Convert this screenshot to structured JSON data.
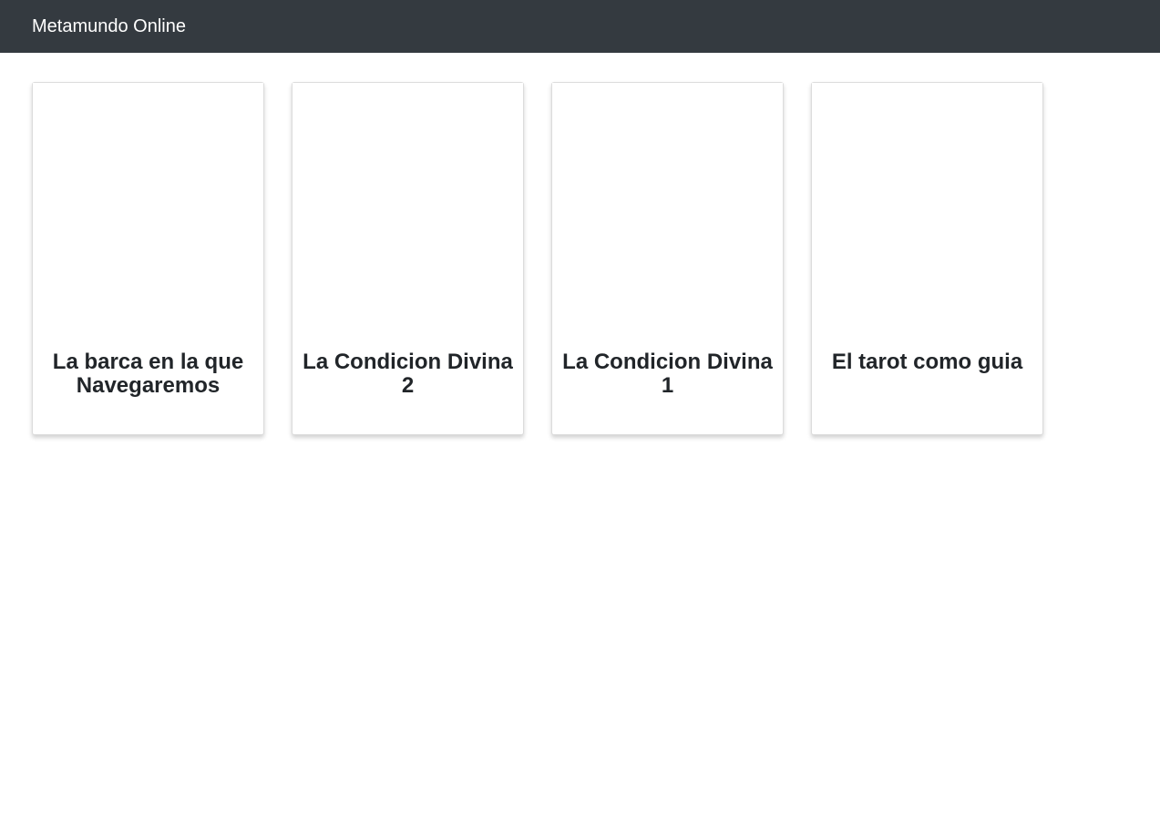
{
  "navbar": {
    "brand": "Metamundo Online"
  },
  "cards": [
    {
      "title": "La barca en la que Navegaremos"
    },
    {
      "title": "La Condicion Divina 2"
    },
    {
      "title": "La Condicion Divina 1"
    },
    {
      "title": "El tarot como guia"
    }
  ]
}
